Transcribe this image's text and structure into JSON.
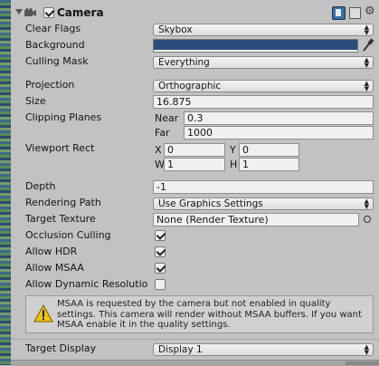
{
  "component": {
    "title": "Camera",
    "enabled": true
  },
  "fields": {
    "clear_flags": {
      "label": "Clear Flags",
      "value": "Skybox"
    },
    "background": {
      "label": "Background",
      "color": "#2b4c7a"
    },
    "culling_mask": {
      "label": "Culling Mask",
      "value": "Everything"
    },
    "projection": {
      "label": "Projection",
      "value": "Orthographic"
    },
    "size": {
      "label": "Size",
      "value": "16.875"
    },
    "clipping_planes": {
      "label": "Clipping Planes",
      "near_label": "Near",
      "near_value": "0.3",
      "far_label": "Far",
      "far_value": "1000"
    },
    "viewport_rect": {
      "label": "Viewport Rect",
      "x_label": "X",
      "x_value": "0",
      "y_label": "Y",
      "y_value": "0",
      "w_label": "W",
      "w_value": "1",
      "h_label": "H",
      "h_value": "1"
    },
    "depth": {
      "label": "Depth",
      "value": "-1"
    },
    "rendering_path": {
      "label": "Rendering Path",
      "value": "Use Graphics Settings"
    },
    "target_texture": {
      "label": "Target Texture",
      "value": "None (Render Texture)"
    },
    "occlusion_culling": {
      "label": "Occlusion Culling",
      "checked": true
    },
    "allow_hdr": {
      "label": "Allow HDR",
      "checked": true
    },
    "allow_msaa": {
      "label": "Allow MSAA",
      "checked": true
    },
    "allow_dynamic_resolution": {
      "label": "Allow Dynamic Resolutio",
      "checked": false
    },
    "target_display": {
      "label": "Target Display",
      "value": "Display 1"
    }
  },
  "warning": {
    "text": "MSAA is requested by the camera but not enabled in quality settings. This camera will render without MSAA buffers. If you want MSAA enable it in the quality settings."
  },
  "icons": {
    "foldout": "triangle-down-icon",
    "camera": "camera-icon",
    "help": "book-help-icon",
    "preset": "preset-icon",
    "gear": "gear-icon",
    "picker": "eyedropper-icon",
    "warning": "warning-triangle-icon",
    "object_picker": "target-circle-icon"
  },
  "colors": {
    "background": "#2b4c7a",
    "panel": "#c2c2c2"
  }
}
